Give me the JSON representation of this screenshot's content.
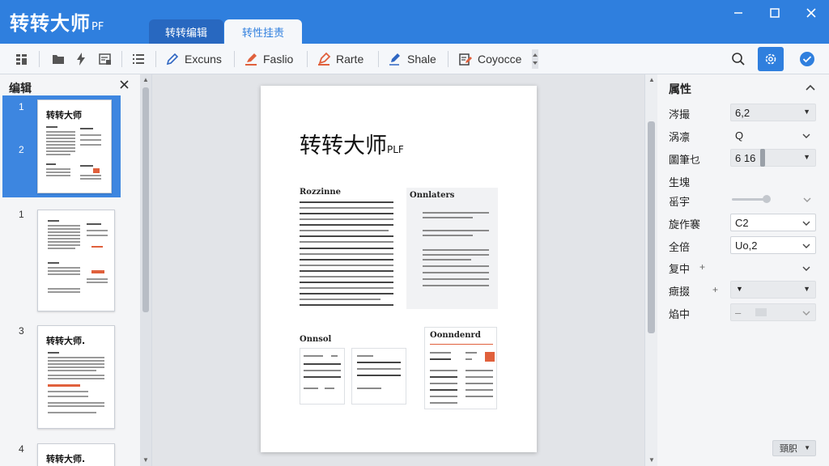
{
  "app": {
    "title": "转转大师",
    "title_suffix": "PF"
  },
  "tabs": [
    {
      "label": "转转编辑"
    },
    {
      "label": "转性挂责"
    }
  ],
  "toolbar": {
    "items": [
      {
        "label": "Excuns",
        "icon": "pencil-icon"
      },
      {
        "label": "Faslio",
        "icon": "highlighter-icon"
      },
      {
        "label": "Rarte",
        "icon": "marker-icon"
      },
      {
        "label": "Shale",
        "icon": "pen-icon"
      },
      {
        "label": "Coyocce",
        "icon": "page-edit-icon"
      }
    ]
  },
  "left_panel": {
    "title": "编辑",
    "thumbnails": [
      {
        "number": "1",
        "sub_number": "2",
        "heading": "转转大师",
        "selected": true
      },
      {
        "number": "1",
        "heading": "",
        "selected": false
      },
      {
        "number": "3",
        "heading": "转转大师.",
        "selected": false
      },
      {
        "number": "4",
        "heading": "转转大师.",
        "selected": false
      }
    ]
  },
  "document": {
    "title": "转转大师",
    "title_suffix": "PLF",
    "section_1": "Rozzinne",
    "sidebar_box": "Onnlaters",
    "section_2": "Onnsol",
    "card_title": "Oonndenrd"
  },
  "properties": {
    "title": "属性",
    "rows": [
      {
        "label": "涔撮",
        "value": "6,2"
      },
      {
        "label": "涡凛",
        "value": "Q"
      },
      {
        "label": "圖筆乜",
        "value": "6  16"
      },
      {
        "label": "生塊",
        "value": ""
      },
      {
        "label": "䍃宇",
        "value": ""
      },
      {
        "label": "旋作褰",
        "value": "C2"
      },
      {
        "label": "全倍",
        "value": "Uo,2"
      },
      {
        "label": "复中",
        "value": ""
      },
      {
        "label": "癍掇",
        "value": ""
      },
      {
        "label": "焰中",
        "value": "–"
      }
    ],
    "bottom_button": "頸胑"
  }
}
